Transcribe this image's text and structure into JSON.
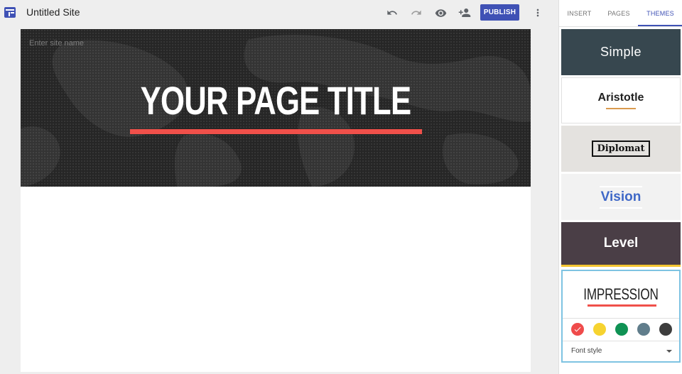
{
  "app": {
    "site_title": "Untitled Site",
    "logo_icon": "site-layout-icon"
  },
  "toolbar": {
    "undo_icon": "undo-icon",
    "redo_icon": "redo-icon",
    "preview_icon": "eye-icon",
    "share_icon": "add-person-icon",
    "publish_label": "PUBLISH",
    "more_icon": "more-vert-icon",
    "accent": "#3f51b5"
  },
  "canvas": {
    "site_name_placeholder": "Enter site name",
    "page_title": "YOUR PAGE TITLE",
    "underline_color": "#f0504a"
  },
  "panel": {
    "tabs": [
      {
        "label": "INSERT"
      },
      {
        "label": "PAGES"
      },
      {
        "label": "THEMES"
      }
    ],
    "active_tab": "THEMES",
    "themes": [
      {
        "name": "Simple"
      },
      {
        "name": "Aristotle"
      },
      {
        "name": "Diplomat"
      },
      {
        "name": "Vision"
      },
      {
        "name": "Level"
      },
      {
        "name": "IMPRESSION"
      }
    ],
    "selected_theme": "IMPRESSION",
    "impression_colors": [
      {
        "color": "#ef4b4b",
        "selected": true
      },
      {
        "color": "#f6d330",
        "selected": false
      },
      {
        "color": "#0f9254",
        "selected": false
      },
      {
        "color": "#607d8b",
        "selected": false
      },
      {
        "color": "#3d3d3d",
        "selected": false
      }
    ],
    "font_style_label": "Font style"
  }
}
